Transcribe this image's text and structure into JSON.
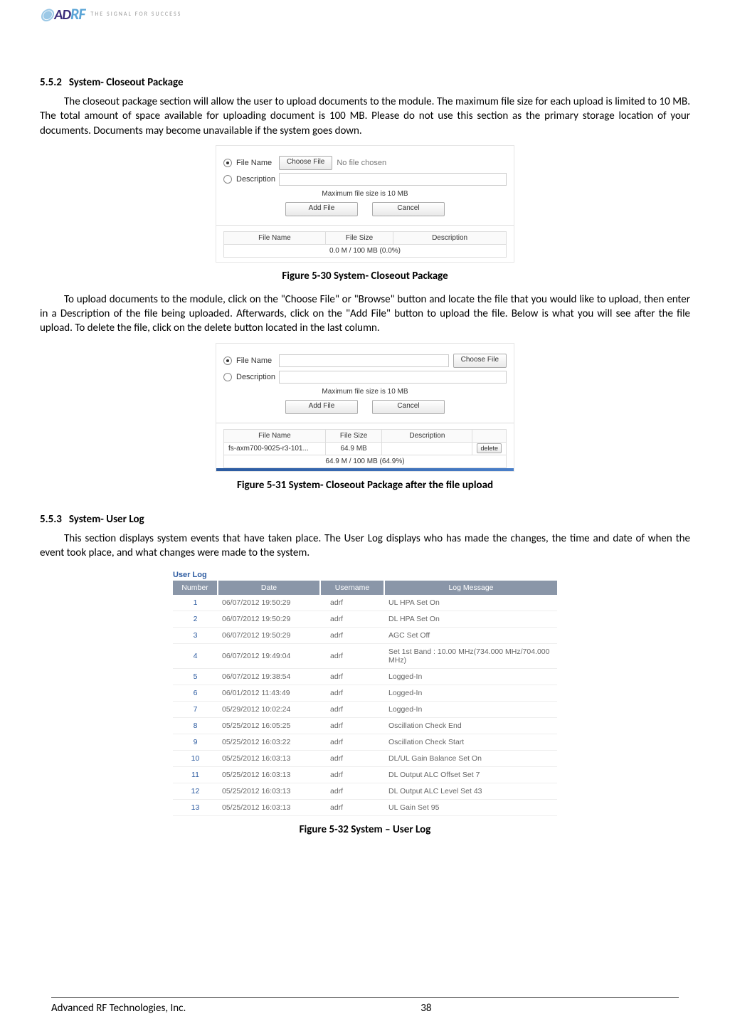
{
  "header": {
    "logo_text": "ADRF",
    "slogan": "THE SIGNAL FOR SUCCESS"
  },
  "sections": {
    "s552": {
      "number": "5.5.2",
      "title": "System- Closeout Package",
      "para1": "The closeout package section will allow the user to upload documents to the module.  The maximum file size for each upload is limited to 10 MB.  The total amount of space available for uploading document is 100 MB.  Please do not use this section as the primary storage location of your documents.  Documents may become unavailable if the system goes down.",
      "para2": "To upload documents to the module, click on the \"Choose File\" or \"Browse\" button and locate the file that you would like to upload, then enter in a Description of the file being uploaded.  Afterwards, click on the \"Add File\" button to upload the file.  Below is what you will see after the file upload.  To delete the file, click on the delete button located in the last column."
    },
    "s553": {
      "number": "5.5.3",
      "title": "System- User Log",
      "para1": "This section displays system events that have taken place.  The User Log displays who has made the changes, the time and date of when the event took place, and what changes were made to the system."
    }
  },
  "fig530": {
    "caption": "Figure 5-30   System- Closeout Package",
    "filename_lbl": "File Name",
    "description_lbl": "Description",
    "choose_btn": "Choose File",
    "nofile": "No file chosen",
    "hint": "Maximum file size is 10 MB",
    "add_btn": "Add File",
    "cancel_btn": "Cancel",
    "cols": {
      "name": "File Name",
      "size": "File Size",
      "desc": "Description"
    },
    "status": "0.0 M / 100 MB (0.0%)"
  },
  "fig531": {
    "caption": "Figure 5-31   System- Closeout Package after the file upload",
    "filename_lbl": "File Name",
    "description_lbl": "Description",
    "choose_btn": "Choose File",
    "hint": "Maximum file size is 10 MB",
    "add_btn": "Add File",
    "cancel_btn": "Cancel",
    "cols": {
      "name": "File Name",
      "size": "File Size",
      "desc": "Description"
    },
    "row": {
      "name": "fs-axm700-9025-r3-101...",
      "size": "64.9 MB",
      "desc": "",
      "del": "delete"
    },
    "status": "64.9 M / 100 MB (64.9%)"
  },
  "fig532": {
    "caption": "Figure 5-32   System – User Log",
    "title": "User Log",
    "headers": {
      "num": "Number",
      "date": "Date",
      "user": "Username",
      "msg": "Log Message"
    },
    "rows": [
      {
        "n": "1",
        "d": "06/07/2012 19:50:29",
        "u": "adrf",
        "m": "UL HPA Set On"
      },
      {
        "n": "2",
        "d": "06/07/2012 19:50:29",
        "u": "adrf",
        "m": "DL HPA Set On"
      },
      {
        "n": "3",
        "d": "06/07/2012 19:50:29",
        "u": "adrf",
        "m": "AGC Set Off"
      },
      {
        "n": "4",
        "d": "06/07/2012 19:49:04",
        "u": "adrf",
        "m": "Set 1st Band : 10.00 MHz(734.000 MHz/704.000 MHz)"
      },
      {
        "n": "5",
        "d": "06/07/2012 19:38:54",
        "u": "adrf",
        "m": "Logged-In"
      },
      {
        "n": "6",
        "d": "06/01/2012 11:43:49",
        "u": "adrf",
        "m": "Logged-In"
      },
      {
        "n": "7",
        "d": "05/29/2012 10:02:24",
        "u": "adrf",
        "m": "Logged-In"
      },
      {
        "n": "8",
        "d": "05/25/2012 16:05:25",
        "u": "adrf",
        "m": "Oscillation Check End"
      },
      {
        "n": "9",
        "d": "05/25/2012 16:03:22",
        "u": "adrf",
        "m": "Oscillation Check Start"
      },
      {
        "n": "10",
        "d": "05/25/2012 16:03:13",
        "u": "adrf",
        "m": "DL/UL Gain Balance Set On"
      },
      {
        "n": "11",
        "d": "05/25/2012 16:03:13",
        "u": "adrf",
        "m": "DL Output ALC Offset Set 7"
      },
      {
        "n": "12",
        "d": "05/25/2012 16:03:13",
        "u": "adrf",
        "m": "DL Output ALC Level Set 43"
      },
      {
        "n": "13",
        "d": "05/25/2012 16:03:13",
        "u": "adrf",
        "m": "UL Gain Set 95"
      }
    ]
  },
  "footer": {
    "company": "Advanced RF Technologies, Inc.",
    "page": "38"
  }
}
